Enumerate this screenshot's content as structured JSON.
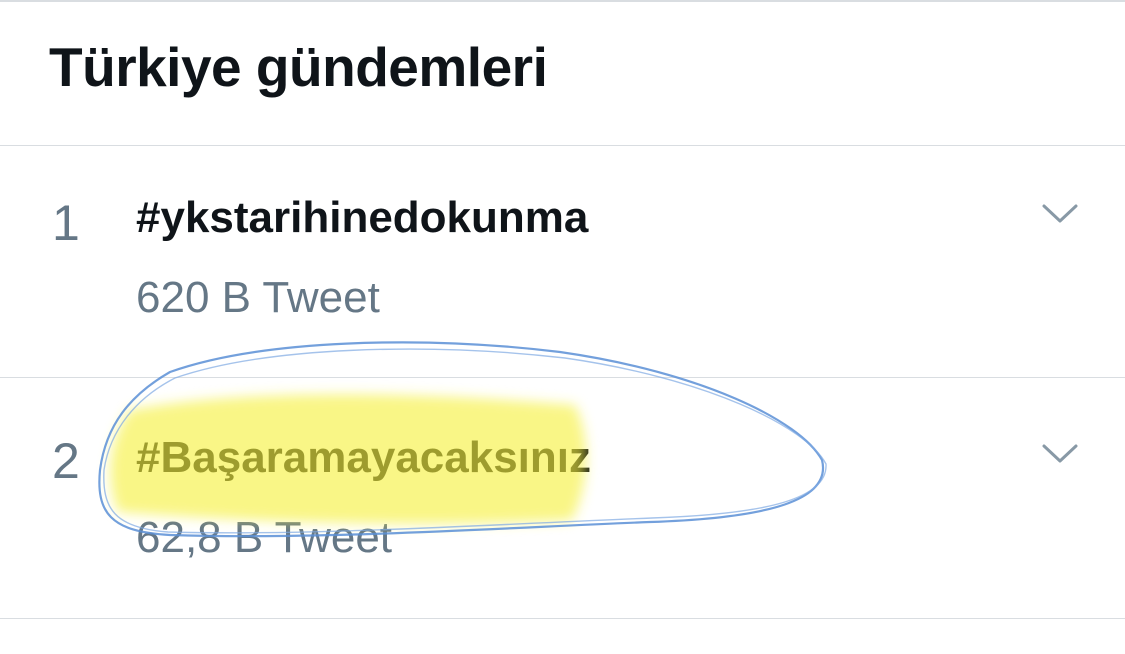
{
  "header": {
    "title": "Türkiye gündemleri"
  },
  "trends": [
    {
      "rank": "1",
      "name": "#ykstarihinedokunma",
      "count": "620 B Tweet",
      "menu_icon": "chevron-down-icon"
    },
    {
      "rank": "2",
      "name": "#Başaramayacaksınız",
      "count": "62,8 B Tweet",
      "menu_icon": "chevron-down-icon"
    }
  ],
  "annotations": {
    "highlight_color": "#f5f03a",
    "circle_color": "#5b8fd6"
  }
}
